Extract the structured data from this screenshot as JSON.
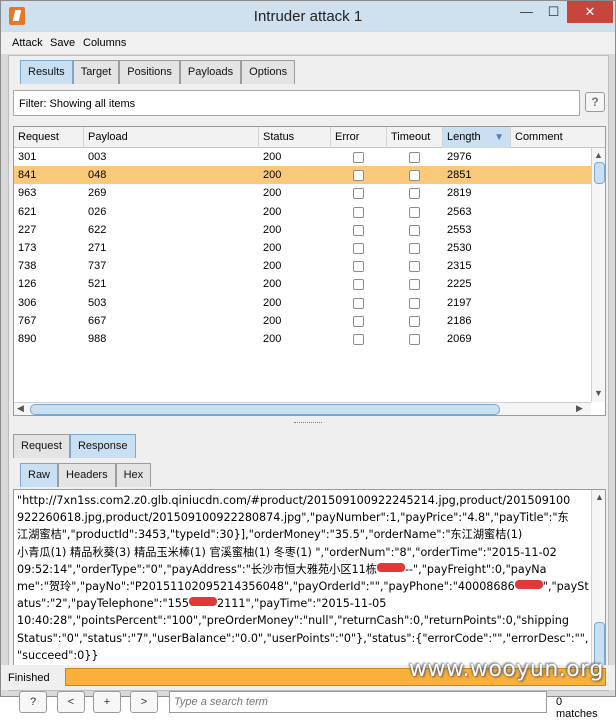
{
  "window": {
    "title": "Intruder attack 1",
    "min_glyph": "—",
    "max_glyph": "☐",
    "close_glyph": "✕"
  },
  "menu": [
    "Attack",
    "Save",
    "Columns"
  ],
  "main_tabs": [
    "Results",
    "Target",
    "Positions",
    "Payloads",
    "Options"
  ],
  "active_main_tab": "Results",
  "filter": {
    "text": "Filter:  Showing all items",
    "help_glyph": "?"
  },
  "table": {
    "columns": [
      "Request",
      "Payload",
      "Status",
      "Error",
      "Timeout",
      "Length",
      "Comment"
    ],
    "sorted_column": "Length",
    "sort_glyph": "▼",
    "selected_index": 1,
    "rows": [
      {
        "request": "301",
        "payload": "003",
        "status": "200",
        "length": "2976"
      },
      {
        "request": "841",
        "payload": "048",
        "status": "200",
        "length": "2851"
      },
      {
        "request": "963",
        "payload": "269",
        "status": "200",
        "length": "2819"
      },
      {
        "request": "621",
        "payload": "026",
        "status": "200",
        "length": "2563"
      },
      {
        "request": "227",
        "payload": "622",
        "status": "200",
        "length": "2553"
      },
      {
        "request": "173",
        "payload": "271",
        "status": "200",
        "length": "2530"
      },
      {
        "request": "738",
        "payload": "737",
        "status": "200",
        "length": "2315"
      },
      {
        "request": "126",
        "payload": "521",
        "status": "200",
        "length": "2225"
      },
      {
        "request": "306",
        "payload": "503",
        "status": "200",
        "length": "2197"
      },
      {
        "request": "767",
        "payload": "667",
        "status": "200",
        "length": "2186"
      },
      {
        "request": "890",
        "payload": "988",
        "status": "200",
        "length": "2069"
      }
    ]
  },
  "detail_tabs": [
    "Request",
    "Response"
  ],
  "active_detail_tab": "Response",
  "view_tabs": [
    "Raw",
    "Headers",
    "Hex"
  ],
  "active_view_tab": "Raw",
  "raw_lines": [
    {
      "a": "\"http://7xn1ss.com2.z0.glb.qiniucdn.com/#product/201509100922245214.jpg,product/201509100"
    },
    {
      "a": "922260618.jpg,product/201509100922280874.jpg\",\"payNumber\":1,\"payPrice\":\"4.8\",\"payTitle\":\"东"
    },
    {
      "a": "江湖蜜桔\",\"productId\":3453,\"typeId\":30}],\"orderMoney\":\"35.5\",\"orderName\":\"东江湖蜜桔(1)"
    },
    {
      "a": "小青瓜(1) 精品秋葵(3) 精品玉米棒(1) 官溪蜜柚(1) 冬枣(1) \",\"orderNum\":\"8\",\"orderTime\":\"2015-11-02"
    },
    {
      "a": "09:52:14\",\"orderType\":\"0\",\"payAddress\":\"长沙市恒大雅苑小区11栋",
      "redact": true,
      "b": "--\",\"payFreight\":0,\"payNa"
    },
    {
      "a": "me\":\"贺玲\",\"payNo\":\"P20151102095214356048\",\"payOrderId\":\"\",\"payPhone\":\"40008686",
      "redact": true,
      "b": "\",\"paySt"
    },
    {
      "a": "atus\":\"2\",\"payTelephone\":\"155",
      "redact": true,
      "b": "2111\",\"payTime\":\"2015-11-05"
    },
    {
      "a": "10:40:28\",\"pointsPercent\":\"100\",\"preOrderMoney\":\"null\",\"returnCash\":0,\"returnPoints\":0,\"shipping"
    },
    {
      "a": "Status\":\"0\",\"status\":\"7\",\"userBalance\":\"0.0\",\"userPoints\":\"0\"},\"status\":{\"errorCode\":\"\",\"errorDesc\":\"\","
    },
    {
      "a": "\"succeed\":0}}"
    }
  ],
  "search": {
    "help_glyph": "?",
    "prev_glyph": "<",
    "add_glyph": "+",
    "next_glyph": ">",
    "placeholder": "Type a search term",
    "matches": "0 matches"
  },
  "status": {
    "text": "Finished",
    "progress": 1.0
  },
  "watermark": "www.wooyun.org",
  "colors": {
    "selected_row": "#fbc97a",
    "active_tab": "#c9dff2",
    "progress": "#fbb03b",
    "close_button": "#c7463b"
  }
}
